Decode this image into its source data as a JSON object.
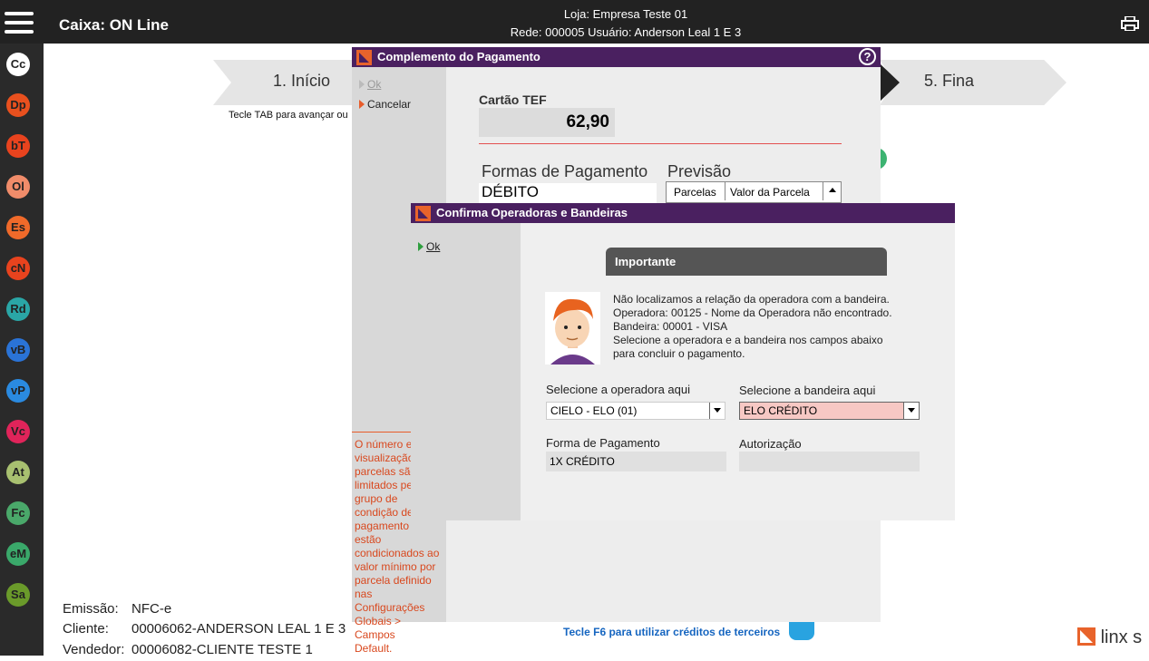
{
  "header": {
    "title": "Caixa: ON Line",
    "store_line1": "Loja: Empresa Teste  01",
    "store_line2": "Rede: 000005 Usuário: Anderson Leal 1 E 3"
  },
  "sidebar": {
    "items": [
      {
        "label": "Cc",
        "color": "#ffffff"
      },
      {
        "label": "Dp",
        "color": "#e8501e"
      },
      {
        "label": "bT",
        "color": "#e8431e"
      },
      {
        "label": "Ol",
        "color": "#f08c6a"
      },
      {
        "label": "Es",
        "color": "#f06a2a"
      },
      {
        "label": "cN",
        "color": "#e8431e"
      },
      {
        "label": "Rd",
        "color": "#2aa6a6"
      },
      {
        "label": "vB",
        "color": "#2a73d6"
      },
      {
        "label": "vP",
        "color": "#2a8ae0"
      },
      {
        "label": "Vc",
        "color": "#e0245a"
      },
      {
        "label": "At",
        "color": "#a8c070"
      },
      {
        "label": "Fc",
        "color": "#4aa86a"
      },
      {
        "label": "eM",
        "color": "#3aa86a"
      },
      {
        "label": "Sa",
        "color": "#6a9a2a"
      }
    ]
  },
  "wizard": {
    "step1": "1. Início",
    "step5": "5. Fina",
    "hint": "Tecle TAB para avançar ou"
  },
  "footer": {
    "emissao_label": "Emissão:",
    "emissao_value": "NFC-e",
    "cliente_label": "Cliente:",
    "cliente_value": "00006062-ANDERSON LEAL 1 E 3",
    "vendedor_label": "Vendedor:",
    "vendedor_value": "00006082-CLIENTE TESTE 1",
    "f6_hint": "Tecle F6 para utilizar créditos de terceiros",
    "brand": "linx s"
  },
  "complemento": {
    "title": "Complemento do Pagamento",
    "ok": "Ok",
    "cancel": "Cancelar",
    "tef_label": "Cartão TEF",
    "tef_value": "62,90",
    "formas_title": "Formas de Pagamento",
    "previsao_title": "Previsão",
    "forma_value": "DÉBITO",
    "col_parcelas": "Parcelas",
    "col_valor": "Valor da Parcela",
    "note": "O número e\nvisualização\nparcelas são\nlimitados pe\ngrupo de\ncondição de\npagamento\nestão\ncondicionados ao\nvalor mínimo por\nparcela definido\nnas Configurações\nGlobais > Campos\nDefault."
  },
  "confirma": {
    "title": "Confirma Operadoras e Bandeiras",
    "ok": "Ok",
    "important_title": "Importante",
    "msg1": "Não localizamos a relação da operadora com a bandeira.",
    "msg2": "Operadora: 00125 - Nome da Operadora não encontrado.",
    "msg3": "Bandeira: 00001 - VISA",
    "msg4": "Selecione a operadora e a bandeira nos campos abaixo",
    "msg5": "para concluir o pagamento.",
    "operadora_label": "Selecione a operadora aqui",
    "operadora_value": "CIELO - ELO (01)",
    "bandeira_label": "Selecione a bandeira aqui",
    "bandeira_value": "ELO CRÉDITO",
    "forma_label": "Forma de Pagamento",
    "forma_value": "1X CRÉDITO",
    "autorizacao_label": "Autorização",
    "autorizacao_value": ""
  }
}
